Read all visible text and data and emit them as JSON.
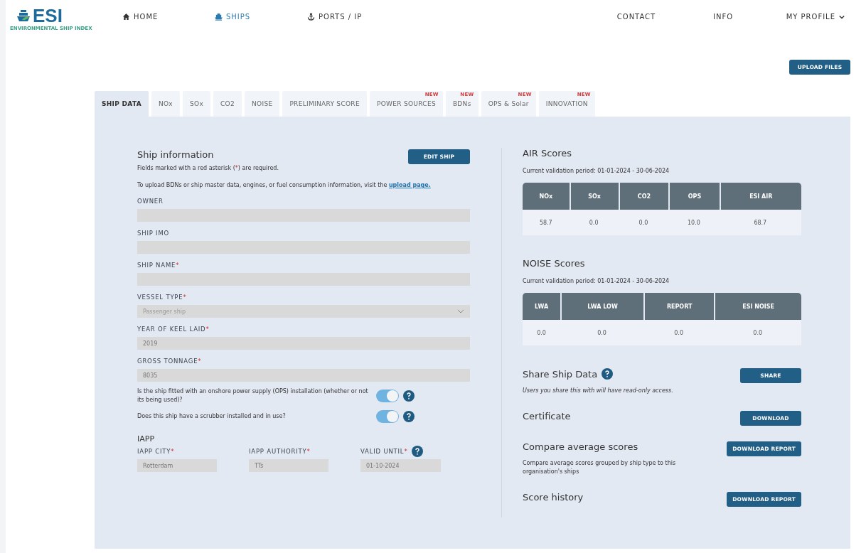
{
  "logo": {
    "mark": "ESI",
    "tagline": "ENVIRONMENTAL SHIP INDEX"
  },
  "nav": {
    "left": [
      {
        "label": "HOME",
        "kind": "home",
        "selected": false
      },
      {
        "label": "SHIPS",
        "kind": "ship",
        "selected": true
      },
      {
        "label": "PORTS / IP",
        "kind": "anchor",
        "selected": false
      }
    ],
    "right": [
      {
        "label": "CONTACT",
        "dropdown": false
      },
      {
        "label": "INFO",
        "dropdown": false
      },
      {
        "label": "MY PROFILE",
        "dropdown": true
      }
    ]
  },
  "upload_button": "UPLOAD FILES",
  "tabs": [
    {
      "label": "SHIP DATA",
      "selected": true
    },
    {
      "label": "NOx",
      "selected": false
    },
    {
      "label": "SOx",
      "selected": false
    },
    {
      "label": "CO2",
      "selected": false
    },
    {
      "label": "NOISE",
      "selected": false
    },
    {
      "label": "PRELIMINARY SCORE",
      "selected": false
    },
    {
      "label": "POWER SOURCES",
      "selected": false,
      "badge": "NEW"
    },
    {
      "label": "BDNs",
      "selected": false,
      "badge": "NEW"
    },
    {
      "label": "OPS & Solar",
      "selected": false,
      "badge": "NEW"
    },
    {
      "label": "INNOVATION",
      "selected": false,
      "badge": "NEW"
    }
  ],
  "ship_info": {
    "title": "Ship information",
    "edit_button": "EDIT SHIP",
    "required_note": {
      "before": "Fields marked with a red asterisk (",
      "mark": "*",
      "after": ") are required."
    },
    "upload_note": {
      "text": "To upload BDNs or ship master data, engines, or fuel consumption information, visit the",
      "link": "upload page."
    },
    "fields": [
      {
        "label": "OWNER",
        "required": false,
        "kind": "text"
      },
      {
        "label": "SHIP IMO",
        "required": false,
        "kind": "text"
      },
      {
        "label": "SHIP NAME",
        "required": true,
        "kind": "text"
      },
      {
        "label": "VESSEL TYPE",
        "required": true,
        "kind": "select",
        "value": "Passenger ship"
      },
      {
        "label": "YEAR OF KEEL LAID",
        "required": true,
        "kind": "text",
        "value": "2019"
      },
      {
        "label": "GROSS TONNAGE",
        "required": true,
        "kind": "text",
        "value": "8035"
      }
    ],
    "toggles": [
      {
        "label": "Is the ship fitted with an onshore power supply (OPS) installation (whether or not its being used)?",
        "on": true
      },
      {
        "label": "Does this ship have a scrubber installed and in use?",
        "on": true
      }
    ],
    "iapp": {
      "title": "IAPP",
      "fields": [
        {
          "label": "IAPP CITY",
          "required": true,
          "help": false,
          "value": "Rotterdam"
        },
        {
          "label": "IAPP AUTHORITY",
          "required": true,
          "help": false,
          "value": "TTs"
        },
        {
          "label": "VALID UNTIL",
          "required": true,
          "help": true,
          "value": "01-10-2024"
        }
      ]
    }
  },
  "scores": [
    {
      "title": "AIR Scores",
      "period": "Current validation period: 01-01-2024 - 30-06-2024",
      "columns": [
        "NOx",
        "SOx",
        "CO2",
        "OPS",
        "ESI AIR"
      ],
      "values": [
        "58.7",
        "0.0",
        "0.0",
        "10.0",
        "68.7"
      ]
    },
    {
      "title": "NOISE Scores",
      "period": "Current validation period: 01-01-2024 - 30-06-2024",
      "columns": [
        "LWA",
        "LWA LOW",
        "REPORT",
        "ESI NOISE"
      ],
      "values": [
        "0.0",
        "0.0",
        "0.0",
        "0.0"
      ]
    }
  ],
  "actions": [
    {
      "title": "Share Ship Data",
      "help": true,
      "button": "SHARE",
      "note": "Users you share this with will have read-only access.",
      "italic": true
    },
    {
      "title": "Certificate",
      "help": false,
      "button": "DOWNLOAD"
    },
    {
      "title": "Compare average scores",
      "help": false,
      "button": "DOWNLOAD REPORT",
      "note": "Compare average scores grouped by ship type to this organisation's ships",
      "italic": false
    },
    {
      "title": "Score history",
      "help": false,
      "button": "DOWNLOAD REPORT"
    }
  ]
}
